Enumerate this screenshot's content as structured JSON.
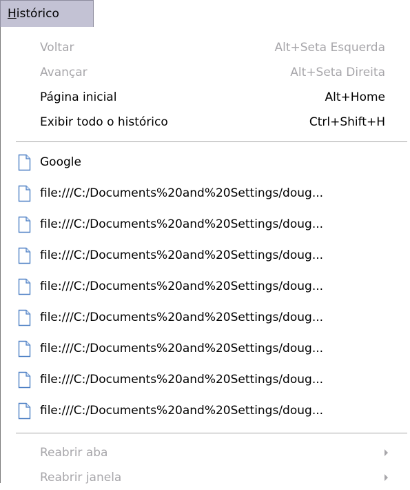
{
  "menubar": {
    "title_accel": "H",
    "title_rest": "istórico"
  },
  "menu": {
    "nav": [
      {
        "label": "Voltar",
        "shortcut": "Alt+Seta Esquerda",
        "enabled": false
      },
      {
        "label": "Avançar",
        "shortcut": "Alt+Seta Direita",
        "enabled": false
      },
      {
        "label": "Página inicial",
        "shortcut": "Alt+Home",
        "enabled": true
      },
      {
        "label": "Exibir todo o histórico",
        "shortcut": "Ctrl+Shift+H",
        "enabled": true
      }
    ],
    "history": [
      {
        "label": "Google",
        "icon": "document-icon"
      },
      {
        "label": "file:///C:/Documents%20and%20Settings/doug...",
        "icon": "document-icon"
      },
      {
        "label": "file:///C:/Documents%20and%20Settings/doug...",
        "icon": "document-icon"
      },
      {
        "label": "file:///C:/Documents%20and%20Settings/doug...",
        "icon": "document-icon"
      },
      {
        "label": "file:///C:/Documents%20and%20Settings/doug...",
        "icon": "document-icon"
      },
      {
        "label": "file:///C:/Documents%20and%20Settings/doug...",
        "icon": "document-icon"
      },
      {
        "label": "file:///C:/Documents%20and%20Settings/doug...",
        "icon": "document-icon"
      },
      {
        "label": "file:///C:/Documents%20and%20Settings/doug...",
        "icon": "document-icon"
      },
      {
        "label": "file:///C:/Documents%20and%20Settings/doug...",
        "icon": "document-icon"
      }
    ],
    "reopen": [
      {
        "label": "Reabrir aba",
        "enabled": false,
        "submenu_icon": "chevron-right-icon"
      },
      {
        "label": "Reabrir janela",
        "enabled": false,
        "submenu_icon": "chevron-right-icon"
      }
    ]
  },
  "colors": {
    "menubar_active": "#c3c2d4",
    "disabled_text": "#a7a6aa",
    "icon_blue": "#4c7fc4"
  }
}
